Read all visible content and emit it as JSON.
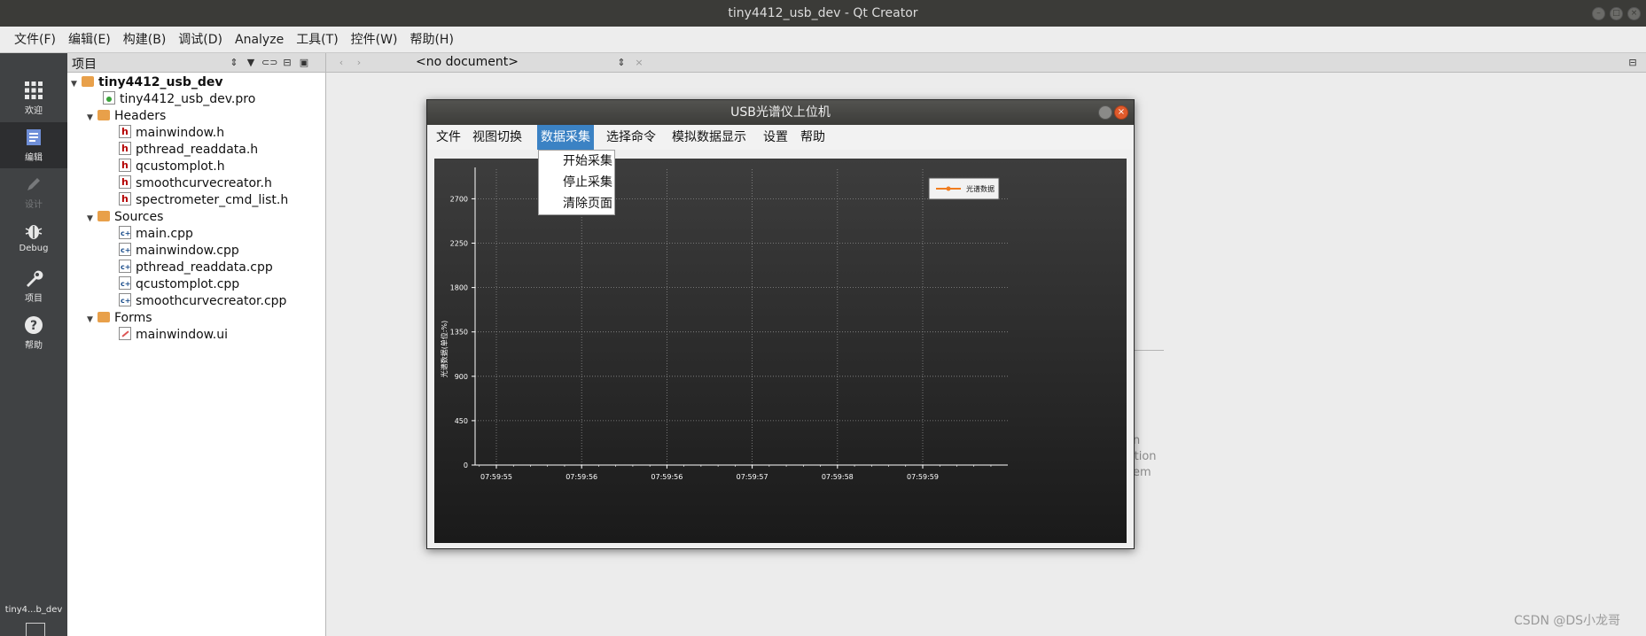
{
  "window": {
    "title": "tiny4412_usb_dev - Qt Creator"
  },
  "menubar": [
    "文件(F)",
    "编辑(E)",
    "构建(B)",
    "调试(D)",
    "Analyze",
    "工具(T)",
    "控件(W)",
    "帮助(H)"
  ],
  "modes": [
    {
      "label": "欢迎",
      "icon": "grid-icon"
    },
    {
      "label": "编辑",
      "icon": "document-icon"
    },
    {
      "label": "设计",
      "icon": "pencil-icon"
    },
    {
      "label": "Debug",
      "icon": "bug-icon"
    },
    {
      "label": "项目",
      "icon": "wrench-icon"
    },
    {
      "label": "帮助",
      "icon": "help-icon"
    }
  ],
  "project_label": "tiny4...b_dev",
  "project_panel": {
    "title": "项目",
    "tree": [
      {
        "label": "tiny4412_usb_dev",
        "bold": true
      },
      {
        "label": "tiny4412_usb_dev.pro"
      },
      {
        "label": "Headers"
      },
      {
        "label": "mainwindow.h"
      },
      {
        "label": "pthread_readdata.h"
      },
      {
        "label": "qcustomplot.h"
      },
      {
        "label": "smoothcurvecreator.h"
      },
      {
        "label": "spectrometer_cmd_list.h"
      },
      {
        "label": "Sources"
      },
      {
        "label": "main.cpp"
      },
      {
        "label": "mainwindow.cpp"
      },
      {
        "label": "pthread_readdata.cpp"
      },
      {
        "label": "qcustomplot.cpp"
      },
      {
        "label": "smoothcurvecreator.cpp"
      },
      {
        "label": "Forms"
      },
      {
        "label": "mainwindow.ui"
      }
    ]
  },
  "editor": {
    "document_selector": "<no document>",
    "hint_lines": [
      "n",
      "ition",
      "em"
    ]
  },
  "app": {
    "title": "USB光谱仪上位机",
    "menus": [
      "文件",
      "视图切换",
      "数据采集",
      "选择命令",
      "模拟数据显示",
      "设置",
      "帮助"
    ],
    "dropdown": [
      "开始采集",
      "停止采集",
      "清除页面"
    ]
  },
  "chart_data": {
    "type": "line",
    "ylabel": "光谱数据(单位:%)",
    "ylim": [
      0,
      3000
    ],
    "yticks": [
      0,
      450,
      900,
      1350,
      1800,
      2250,
      2700
    ],
    "xticks": [
      "07:59:55",
      "07:59:56",
      "07:59:56",
      "07:59:57",
      "07:59:58",
      "07:59:59"
    ],
    "series": [
      {
        "name": "光谱数据",
        "values": []
      }
    ],
    "grid": true,
    "legend": "top-right",
    "colors": {
      "background_top": "#3d3d3d",
      "background_bottom": "#1a1a1a",
      "series": "#f07c1e",
      "grid": "#8a8a8a"
    }
  },
  "watermark": "CSDN @DS小龙哥"
}
